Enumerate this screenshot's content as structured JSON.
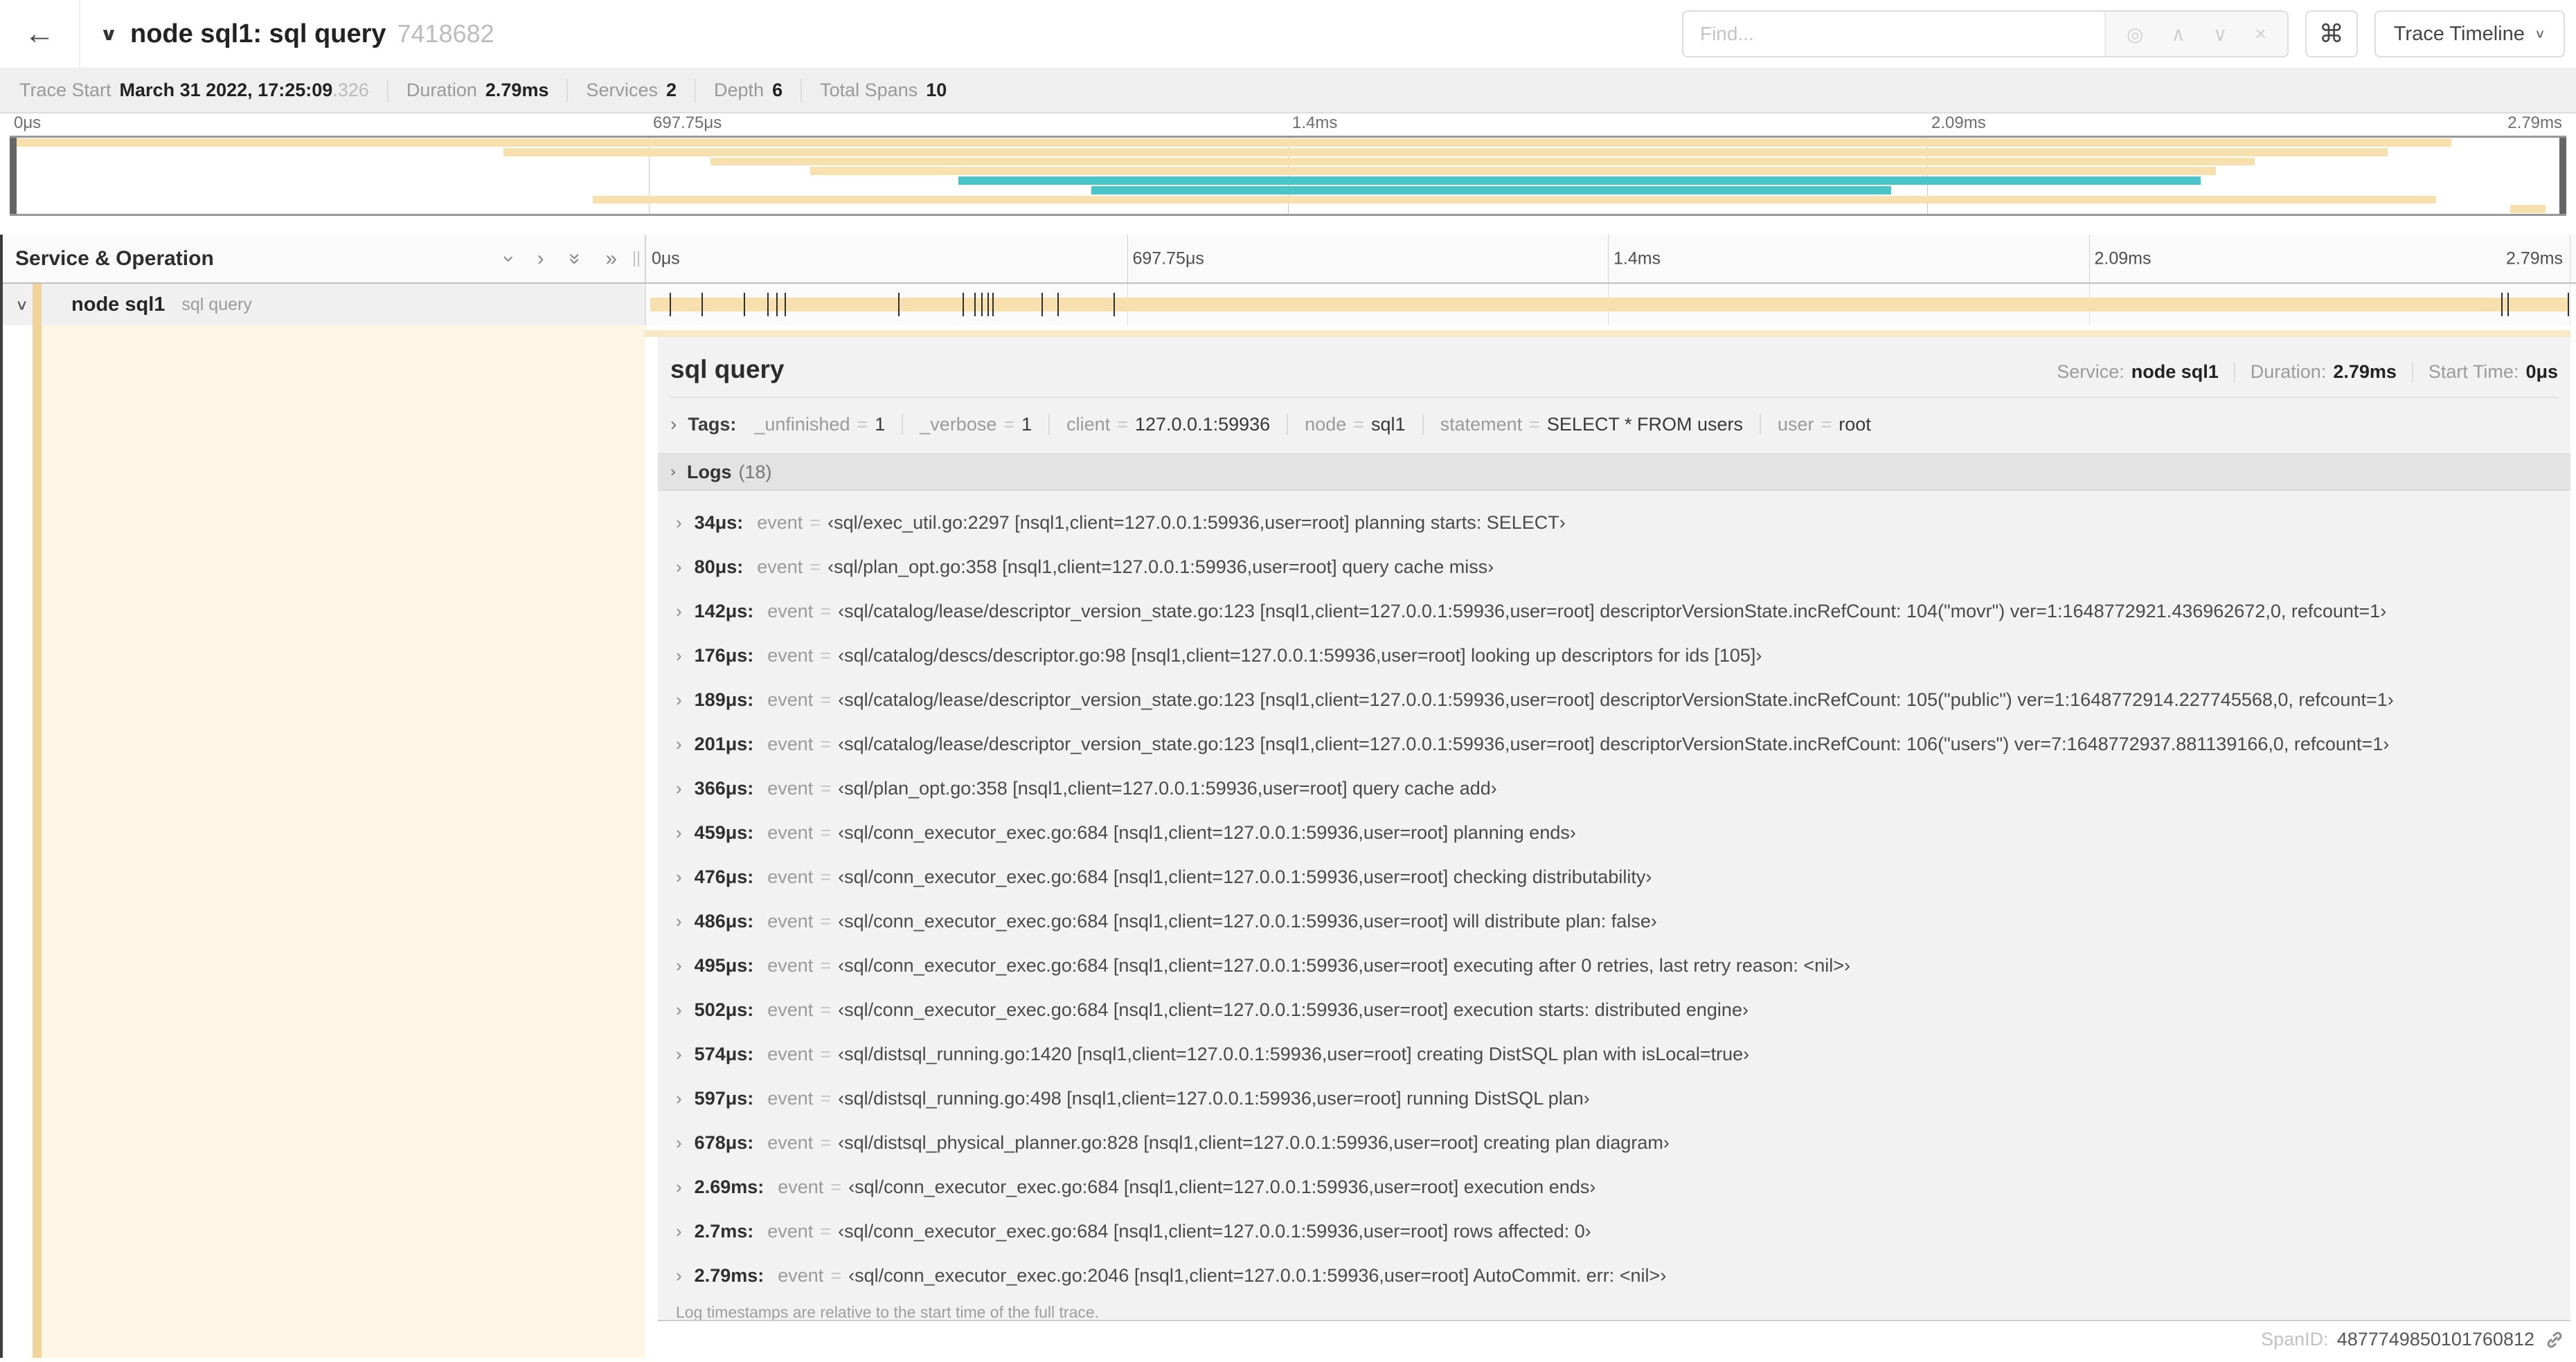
{
  "colors": {
    "tan": "#f7e0ae",
    "tan_light": "#f9e8c6",
    "tan_stripe": "#f0d399",
    "cream": "#fdf6e4",
    "teal": "#48c5c8"
  },
  "header": {
    "back_icon": "←",
    "collapse_icon": "∨",
    "title": "node sql1: sql query",
    "trace_id": "7418682",
    "find_placeholder": "Find...",
    "tool_icons": {
      "match": "◎",
      "prev": "∧",
      "next": "∨",
      "clear": "×"
    },
    "shortcut_button": "⌘",
    "view_button": "Trace Timeline",
    "view_carat": "∨"
  },
  "info_bar": {
    "items": [
      {
        "label": "Trace Start",
        "value": "March 31 2022, 17:25:09",
        "suffix": ".326"
      },
      {
        "label": "Duration",
        "value": "2.79ms"
      },
      {
        "label": "Services",
        "value": "2"
      },
      {
        "label": "Depth",
        "value": "6"
      },
      {
        "label": "Total Spans",
        "value": "10"
      }
    ]
  },
  "timeline": {
    "column_header": "Service & Operation",
    "ticks": [
      "0μs",
      "697.75μs",
      "1.4ms",
      "2.09ms",
      "2.79ms"
    ],
    "tick_pcts": [
      0,
      25,
      50,
      75,
      100
    ]
  },
  "minimap": {
    "bars": [
      {
        "row": 0,
        "start": 0,
        "end": 95.5,
        "color": "tan"
      },
      {
        "row": 1,
        "start": 19.3,
        "end": 93.0,
        "color": "tan"
      },
      {
        "row": 2,
        "start": 27.4,
        "end": 87.8,
        "color": "tan"
      },
      {
        "row": 3,
        "start": 31.3,
        "end": 86.3,
        "color": "tan"
      },
      {
        "row": 4,
        "start": 37.1,
        "end": 85.7,
        "color": "teal"
      },
      {
        "row": 5,
        "start": 42.3,
        "end": 73.6,
        "color": "teal"
      },
      {
        "row": 6,
        "start": 22.8,
        "end": 94.9,
        "color": "tan"
      },
      {
        "row": 7,
        "start": 97.8,
        "end": 99.2,
        "color": "tan"
      }
    ],
    "rows": 8
  },
  "span_row": {
    "chevron": "∨",
    "service": "node sql1",
    "operation": "sql query",
    "bar": {
      "start": 0.2,
      "end": 99.9,
      "color": "tan"
    },
    "log_marks_pct": [
      1.22,
      2.87,
      5.09,
      6.31,
      6.77,
      7.2,
      13.12,
      16.45,
      17.06,
      17.42,
      17.74,
      17.99,
      20.57,
      21.4,
      24.3,
      96.42,
      96.77,
      99.9
    ]
  },
  "detail": {
    "title": "sql query",
    "meta": [
      {
        "label": "Service:",
        "value": "node sql1"
      },
      {
        "label": "Duration:",
        "value": "2.79ms"
      },
      {
        "label": "Start Time:",
        "value": "0μs"
      }
    ],
    "tags_label": "Tags:",
    "tags": [
      {
        "key": "_unfinished",
        "value": "1"
      },
      {
        "key": "_verbose",
        "value": "1"
      },
      {
        "key": "client",
        "value": "127.0.0.1:59936"
      },
      {
        "key": "node",
        "value": "sql1"
      },
      {
        "key": "statement",
        "value": "SELECT * FROM users"
      },
      {
        "key": "user",
        "value": "root"
      }
    ],
    "logs_label": "Logs",
    "logs_count": "(18)",
    "log_field_key": "event",
    "logs": [
      {
        "time": "34μs:",
        "value": "‹sql/exec_util.go:2297 [nsql1,client=127.0.0.1:59936,user=root] planning starts: SELECT›"
      },
      {
        "time": "80μs:",
        "value": "‹sql/plan_opt.go:358 [nsql1,client=127.0.0.1:59936,user=root] query cache miss›"
      },
      {
        "time": "142μs:",
        "value": "‹sql/catalog/lease/descriptor_version_state.go:123 [nsql1,client=127.0.0.1:59936,user=root] descriptorVersionState.incRefCount: 104(\"movr\") ver=1:1648772921.436962672,0, refcount=1›"
      },
      {
        "time": "176μs:",
        "value": "‹sql/catalog/descs/descriptor.go:98 [nsql1,client=127.0.0.1:59936,user=root] looking up descriptors for ids [105]›"
      },
      {
        "time": "189μs:",
        "value": "‹sql/catalog/lease/descriptor_version_state.go:123 [nsql1,client=127.0.0.1:59936,user=root] descriptorVersionState.incRefCount: 105(\"public\") ver=1:1648772914.227745568,0, refcount=1›"
      },
      {
        "time": "201μs:",
        "value": "‹sql/catalog/lease/descriptor_version_state.go:123 [nsql1,client=127.0.0.1:59936,user=root] descriptorVersionState.incRefCount: 106(\"users\") ver=7:1648772937.881139166,0, refcount=1›"
      },
      {
        "time": "366μs:",
        "value": "‹sql/plan_opt.go:358 [nsql1,client=127.0.0.1:59936,user=root] query cache add›"
      },
      {
        "time": "459μs:",
        "value": "‹sql/conn_executor_exec.go:684 [nsql1,client=127.0.0.1:59936,user=root] planning ends›"
      },
      {
        "time": "476μs:",
        "value": "‹sql/conn_executor_exec.go:684 [nsql1,client=127.0.0.1:59936,user=root] checking distributability›"
      },
      {
        "time": "486μs:",
        "value": "‹sql/conn_executor_exec.go:684 [nsql1,client=127.0.0.1:59936,user=root] will distribute plan: false›"
      },
      {
        "time": "495μs:",
        "value": "‹sql/conn_executor_exec.go:684 [nsql1,client=127.0.0.1:59936,user=root] executing after 0 retries, last retry reason: <nil>›"
      },
      {
        "time": "502μs:",
        "value": "‹sql/conn_executor_exec.go:684 [nsql1,client=127.0.0.1:59936,user=root] execution starts: distributed engine›"
      },
      {
        "time": "574μs:",
        "value": "‹sql/distsql_running.go:1420 [nsql1,client=127.0.0.1:59936,user=root] creating DistSQL plan with isLocal=true›"
      },
      {
        "time": "597μs:",
        "value": "‹sql/distsql_running.go:498 [nsql1,client=127.0.0.1:59936,user=root] running DistSQL plan›"
      },
      {
        "time": "678μs:",
        "value": "‹sql/distsql_physical_planner.go:828 [nsql1,client=127.0.0.1:59936,user=root] creating plan diagram›"
      },
      {
        "time": "2.69ms:",
        "value": "‹sql/conn_executor_exec.go:684 [nsql1,client=127.0.0.1:59936,user=root] execution ends›"
      },
      {
        "time": "2.7ms:",
        "value": "‹sql/conn_executor_exec.go:684 [nsql1,client=127.0.0.1:59936,user=root] rows affected: 0›"
      },
      {
        "time": "2.79ms:",
        "value": "‹sql/conn_executor_exec.go:2046 [nsql1,client=127.0.0.1:59936,user=root] AutoCommit. err: <nil>›"
      }
    ],
    "footnote": "Log timestamps are relative to the start time of the full trace.",
    "spanid_label": "SpanID:",
    "spanid": "4877749850101760812"
  }
}
